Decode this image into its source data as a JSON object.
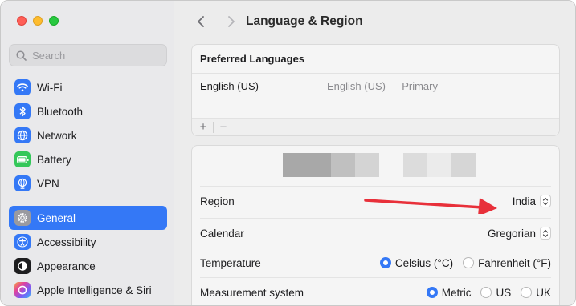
{
  "sidebar": {
    "search_placeholder": "Search",
    "items": [
      {
        "label": "Wi-Fi",
        "icon": "wifi-icon",
        "color": "#3478f6"
      },
      {
        "label": "Bluetooth",
        "icon": "bluetooth-icon",
        "color": "#3478f6"
      },
      {
        "label": "Network",
        "icon": "globe-icon",
        "color": "#3478f6"
      },
      {
        "label": "Battery",
        "icon": "battery-icon",
        "color": "#34c759"
      },
      {
        "label": "VPN",
        "icon": "vpn-globe-icon",
        "color": "#3478f6"
      },
      {
        "label": "General",
        "icon": "gear-icon",
        "color": "#8e8e93",
        "active": true
      },
      {
        "label": "Accessibility",
        "icon": "accessibility-icon",
        "color": "#3478f6"
      },
      {
        "label": "Appearance",
        "icon": "appearance-icon",
        "color": "#1d1d1f"
      },
      {
        "label": "Apple Intelligence & Siri",
        "icon": "siri-icon",
        "color": "#e040a0"
      }
    ]
  },
  "header": {
    "title": "Language & Region"
  },
  "preferred_languages": {
    "heading": "Preferred Languages",
    "languages": [
      {
        "name": "English (US)",
        "description": "English (US) — Primary"
      }
    ],
    "add_label": "+",
    "remove_label": "−"
  },
  "settings": {
    "region": {
      "label": "Region",
      "value": "India"
    },
    "calendar": {
      "label": "Calendar",
      "value": "Gregorian"
    },
    "temperature": {
      "label": "Temperature",
      "options": [
        "Celsius (°C)",
        "Fahrenheit (°F)"
      ],
      "selected": "Celsius (°C)"
    },
    "measurement": {
      "label": "Measurement system",
      "options": [
        "Metric",
        "US",
        "UK"
      ],
      "selected": "Metric"
    }
  },
  "colors": {
    "accent": "#3478f6",
    "annotation_arrow": "#e8303a"
  }
}
